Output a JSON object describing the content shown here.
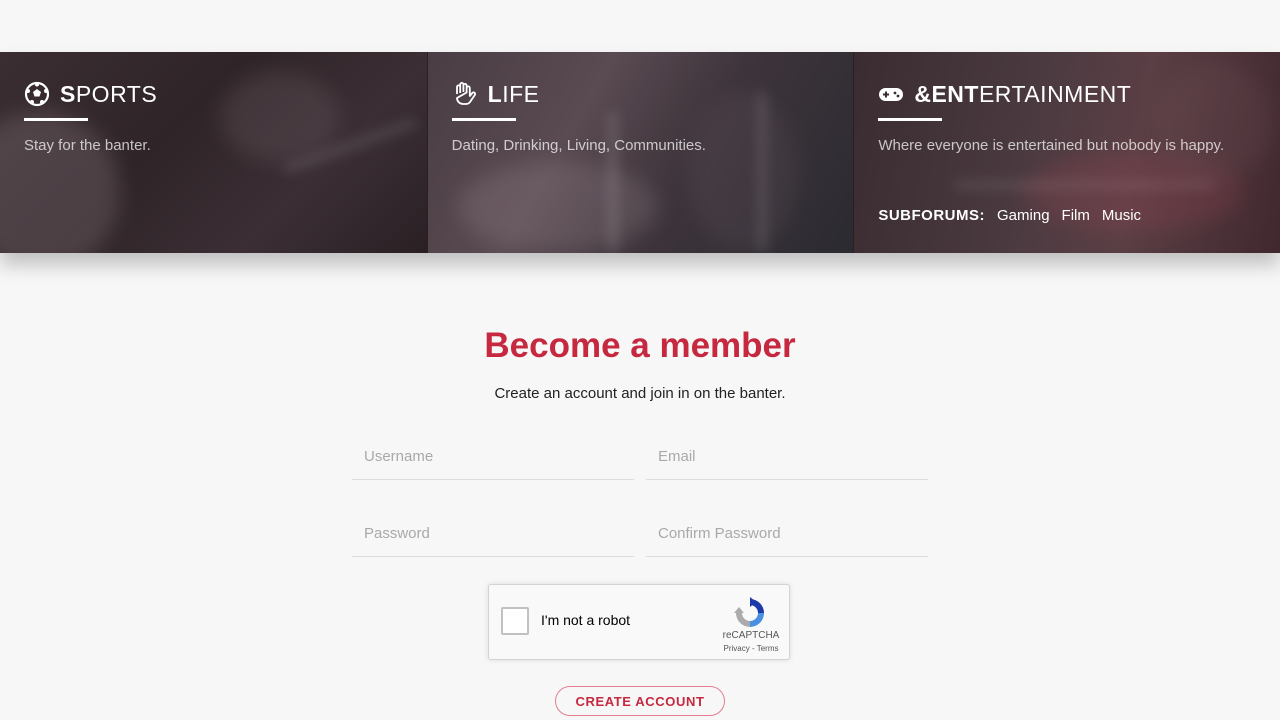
{
  "categories": [
    {
      "title_strong": "S",
      "title_light": "PORTS",
      "icon": "soccer-ball-icon",
      "description": "Stay for the banter."
    },
    {
      "title_strong": "L",
      "title_light": "IFE",
      "icon": "hand-icon",
      "description": "Dating, Drinking, Living, Communities."
    },
    {
      "title_strong": "&ENT",
      "title_light": "ERTAINMENT",
      "icon": "gamepad-icon",
      "description": "Where everyone is entertained but nobody is happy.",
      "subforums_label": "SUBFORUMS:",
      "subforums": [
        "Gaming",
        "Film",
        "Music"
      ]
    }
  ],
  "signup": {
    "title": "Become a member",
    "subtitle": "Create an account and join in on the banter.",
    "username_placeholder": "Username",
    "email_placeholder": "Email",
    "password_placeholder": "Password",
    "confirm_password_placeholder": "Confirm Password",
    "submit_label": "CREATE ACCOUNT"
  },
  "captcha": {
    "label": "I'm not a robot",
    "brand": "reCAPTCHA",
    "links": "Privacy - Terms"
  },
  "colors": {
    "accent": "#c5283f",
    "page_background": "#f7f7f7"
  }
}
